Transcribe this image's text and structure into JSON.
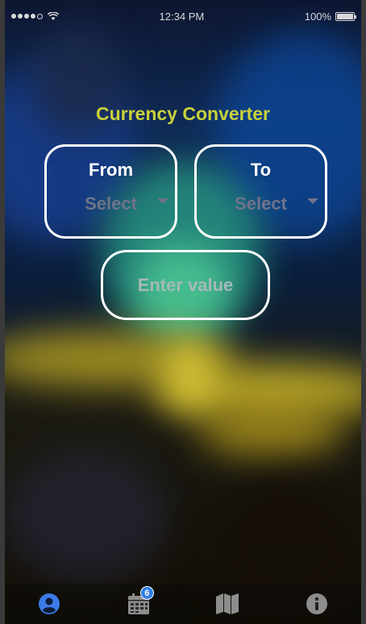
{
  "status_bar": {
    "time": "12:34 PM",
    "battery": "100%"
  },
  "app": {
    "title": "Currency Converter",
    "title_color": "#c9d13a"
  },
  "from_picker": {
    "label": "From",
    "value": "Select"
  },
  "to_picker": {
    "label": "To",
    "value": "Select"
  },
  "amount_input": {
    "placeholder": "Enter value",
    "value": ""
  },
  "tab_bar": {
    "tabs": [
      {
        "icon": "user-circle-icon",
        "active": true,
        "color": "#3b7be6"
      },
      {
        "icon": "calendar-icon",
        "badge": "6",
        "color": "#8d8d8d"
      },
      {
        "icon": "map-icon",
        "color": "#8d8d8d"
      },
      {
        "icon": "info-icon",
        "color": "#8d8d8d"
      }
    ]
  }
}
